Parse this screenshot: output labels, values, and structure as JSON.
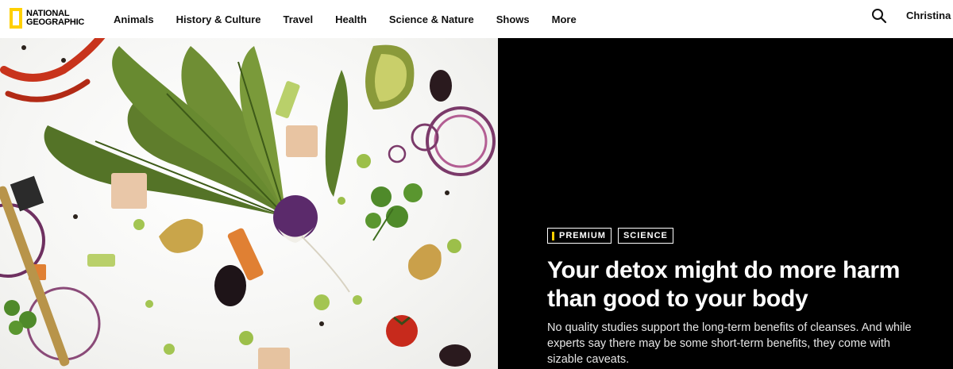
{
  "brand": {
    "line1": "National",
    "line2": "Geographic",
    "frame_color": "#ffd000"
  },
  "nav": {
    "items": [
      {
        "label": "Animals"
      },
      {
        "label": "History & Culture"
      },
      {
        "label": "Travel"
      },
      {
        "label": "Health"
      },
      {
        "label": "Science & Nature"
      },
      {
        "label": "Shows"
      },
      {
        "label": "More"
      }
    ]
  },
  "header": {
    "search_icon": "search-icon",
    "user_name": "Christina"
  },
  "hero": {
    "tags": [
      {
        "label": "Premium",
        "accent": "#ffd000"
      },
      {
        "label": "Science"
      }
    ],
    "headline": "Your detox might do more harm than good to your body",
    "dek": "No quality studies support the long-term benefits of cleanses. And while experts say there may be some short-term benefits, they come with sizable caveats.",
    "panel_color": "#000000"
  }
}
